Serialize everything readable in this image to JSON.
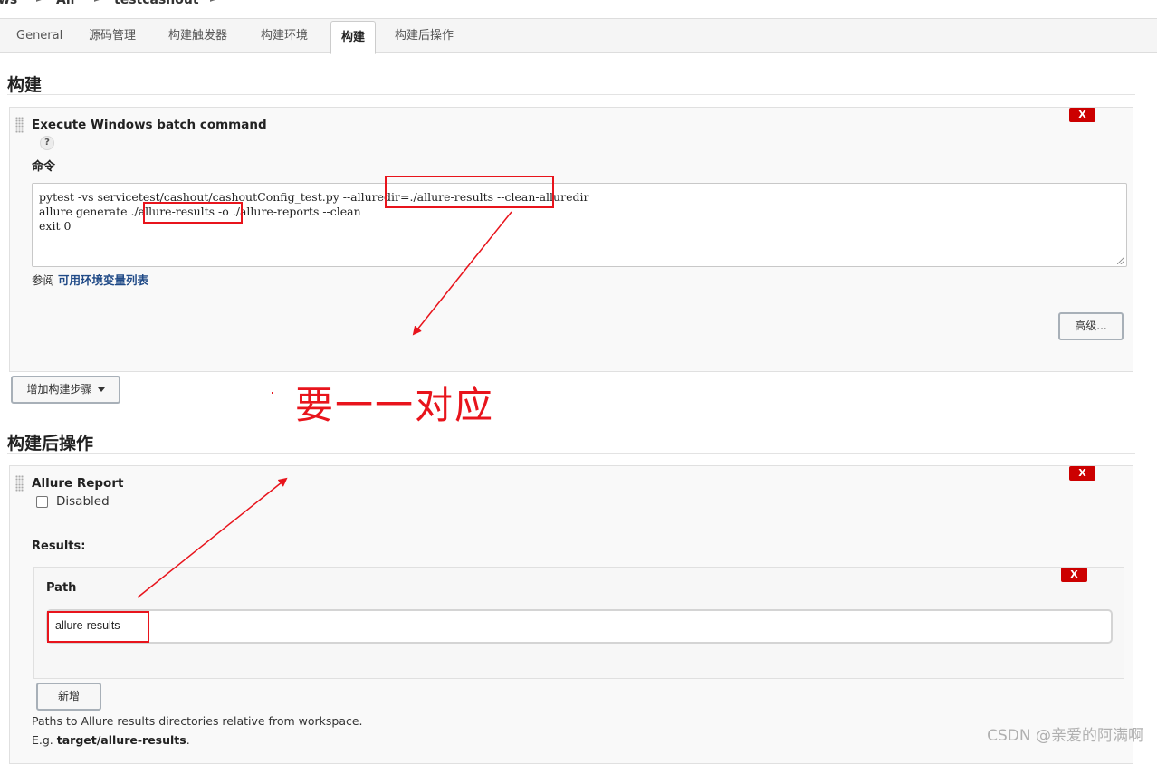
{
  "breadcrumb": {
    "left": "ws",
    "all": "All",
    "job": "testcashout"
  },
  "tabs": [
    "General",
    "源码管理",
    "构建触发器",
    "构建环境",
    "构建",
    "构建后操作"
  ],
  "active_tab": "构建",
  "build_section": {
    "title": "构建",
    "step_title": "Execute Windows batch command",
    "help_icon": "?",
    "command_label": "命令",
    "command_lines": [
      "pytest -vs servicetest/cashout/cashoutConfig_test.py --alluredir=./allure-results --clean-alluredir",
      "allure generate ./allure-results -o ./allure-reports --clean",
      "exit 0"
    ],
    "see_prefix": "参阅",
    "env_link": "可用环境变量列表",
    "advanced_button": "高级...",
    "add_step_button": "增加构建步骤",
    "delete_label": "X"
  },
  "annotation": {
    "text": "要一一对应",
    "color": "#e8141c"
  },
  "post_build_section": {
    "title": "构建后操作",
    "step_title": "Allure Report",
    "disabled_label": "Disabled",
    "disabled_checked": false,
    "results_label": "Results:",
    "path_label": "Path",
    "path_value": "allure-results",
    "add_button": "新增",
    "help_line1": "Paths to Allure results directories relative from workspace.",
    "help_eg_prefix": "E.g. ",
    "help_eg_value": "target/allure-results",
    "help_eg_suffix": ".",
    "delete_label": "X"
  },
  "watermark": "CSDN @亲爱的阿满啊",
  "colors": {
    "delete_red": "#cc0000",
    "annotation_red": "#e8141c",
    "link_blue": "#204a87"
  }
}
